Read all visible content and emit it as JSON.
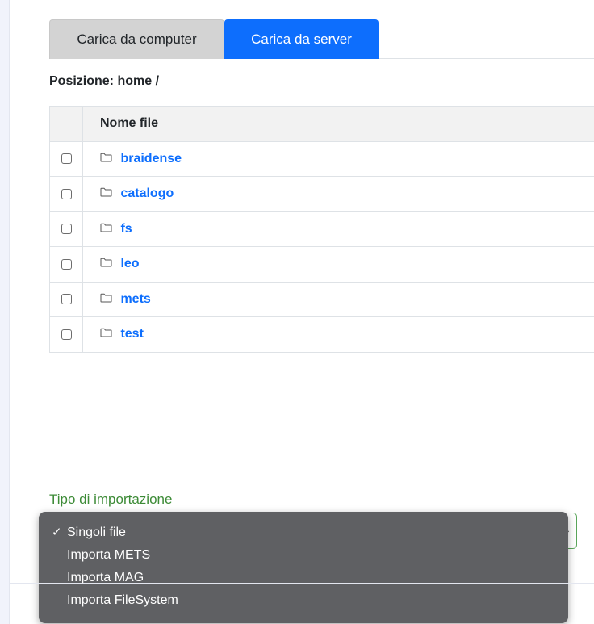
{
  "tabs": [
    {
      "label": "Carica da computer",
      "active": false
    },
    {
      "label": "Carica da server",
      "active": true
    }
  ],
  "position_label": "Posizione: home /",
  "table": {
    "header": "Nome file",
    "rows": [
      {
        "name": "braidense"
      },
      {
        "name": "catalogo"
      },
      {
        "name": "fs"
      },
      {
        "name": "leo"
      },
      {
        "name": "mets"
      },
      {
        "name": "test"
      }
    ]
  },
  "import": {
    "label": "Tipo di importazione",
    "selected": "Singoli file",
    "options": [
      "Singoli file",
      "Importa METS",
      "Importa MAG",
      "Importa FileSystem"
    ]
  },
  "colors": {
    "tab_active": "#0d6efd",
    "tab_inactive": "#d3d3d3",
    "link": "#0d6efd",
    "import_label": "#3d8b37",
    "dropdown_bg": "#5f6063"
  },
  "icons": {
    "folder": "folder-icon",
    "check": "checkmark-icon",
    "select_arrow": "chevron-down-icon"
  }
}
